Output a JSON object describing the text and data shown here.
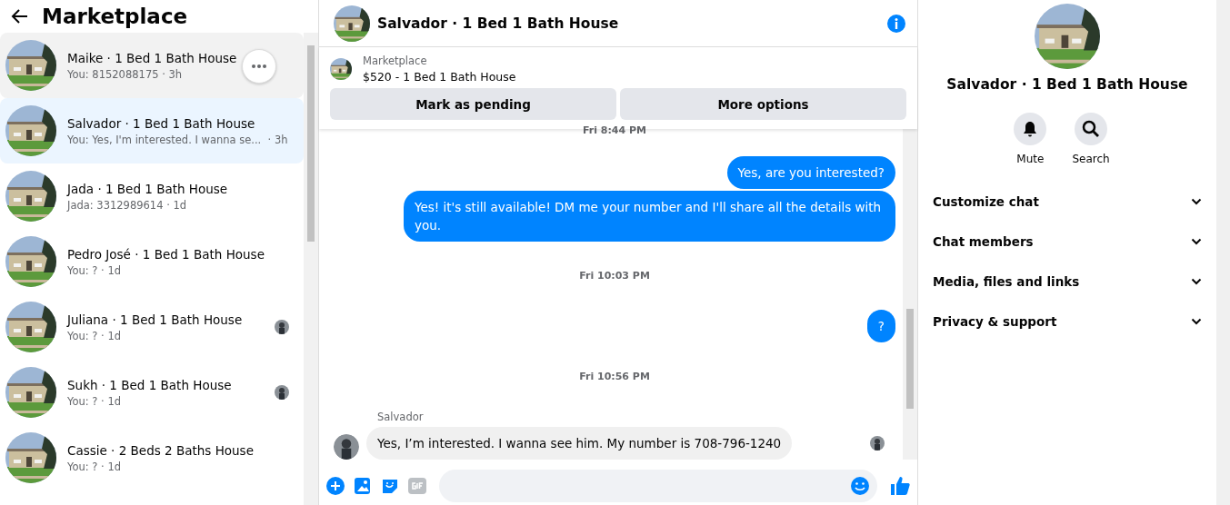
{
  "sidebar": {
    "title": "Marketplace",
    "conversations": [
      {
        "name": "Maike · 1 Bed 1 Bath House",
        "preview": "You: 8152088175 · 3h",
        "selected": false,
        "hovered": true,
        "seen": false
      },
      {
        "name": "Salvador · 1 Bed 1 Bath House",
        "preview": "You: Yes, I'm interested. I wanna se...  · 3h",
        "selected": true,
        "hovered": false,
        "seen": false
      },
      {
        "name": "Jada · 1 Bed 1 Bath House",
        "preview": "Jada: 3312989614 · 1d",
        "selected": false,
        "hovered": false,
        "seen": false
      },
      {
        "name": "Pedro José · 1 Bed 1 Bath House",
        "preview": "You: ? · 1d",
        "selected": false,
        "hovered": false,
        "seen": false
      },
      {
        "name": "Juliana · 1 Bed 1 Bath House",
        "preview": "You: ? · 1d",
        "selected": false,
        "hovered": false,
        "seen": true
      },
      {
        "name": "Sukh · 1 Bed 1 Bath House",
        "preview": "You: ? · 1d",
        "selected": false,
        "hovered": false,
        "seen": true
      },
      {
        "name": "Cassie · 2 Beds 2 Baths House",
        "preview": "You: ? · 1d",
        "selected": false,
        "hovered": false,
        "seen": false
      }
    ]
  },
  "chat": {
    "title": "Salvador · 1 Bed 1 Bath House",
    "listing": {
      "source": "Marketplace",
      "summary": "$520 - 1 Bed 1 Bath House"
    },
    "buttons": [
      "Mark as pending",
      "More options"
    ],
    "messages": [
      {
        "kind": "time",
        "text": "Fri 8:44 PM"
      },
      {
        "kind": "outgoing",
        "text": "Yes, are you interested?"
      },
      {
        "kind": "outgoing",
        "text": "Yes! it's still available! DM me your number and I'll share all the details with you."
      },
      {
        "kind": "time",
        "text": "Fri 10:03 PM"
      },
      {
        "kind": "outgoing",
        "text": "?"
      },
      {
        "kind": "time",
        "text": "Fri 10:56 PM"
      },
      {
        "kind": "incoming",
        "sender": "Salvador",
        "text": "Yes, I’m interested. I wanna see him. My number is 708-796-1240"
      }
    ]
  },
  "info": {
    "title": "Salvador · 1 Bed 1 Bath House",
    "actions": [
      "Mute",
      "Search"
    ],
    "sections": [
      {
        "label": "Customize chat",
        "expanded": false
      },
      {
        "label": "Chat members",
        "expanded": false
      },
      {
        "label": "Media, files and links",
        "expanded": false
      },
      {
        "label": "Privacy & support",
        "expanded": false
      }
    ]
  }
}
